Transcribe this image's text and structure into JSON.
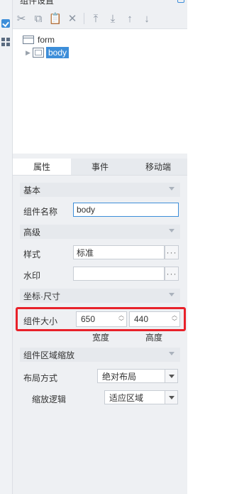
{
  "panel": {
    "title": "组件设置"
  },
  "toolbar": {
    "icons": [
      "scissors-icon",
      "copy-icon",
      "paste-icon",
      "delete-icon",
      "move-top-icon",
      "move-bottom-icon",
      "move-up-icon",
      "move-down-icon"
    ]
  },
  "tree": {
    "root": "form",
    "child": "body"
  },
  "tabs": [
    "属性",
    "事件",
    "移动端"
  ],
  "sections": {
    "basic": "基本",
    "advanced": "高级",
    "coords": "坐标·尺寸",
    "zoom": "组件区域缩放"
  },
  "props": {
    "name_label": "组件名称",
    "name_value": "body",
    "style_label": "样式",
    "style_value": "标准",
    "watermark_label": "水印",
    "watermark_value": "",
    "more_button": "···",
    "size_label": "组件大小",
    "width_value": "650",
    "height_value": "440",
    "width_caption": "宽度",
    "height_caption": "高度",
    "layout_label": "布局方式",
    "layout_value": "绝对布局",
    "scale_label": "缩放逻辑",
    "scale_value": "适应区域"
  },
  "colors": {
    "accent": "#3d8ed9",
    "highlight_border": "#e8212a"
  }
}
